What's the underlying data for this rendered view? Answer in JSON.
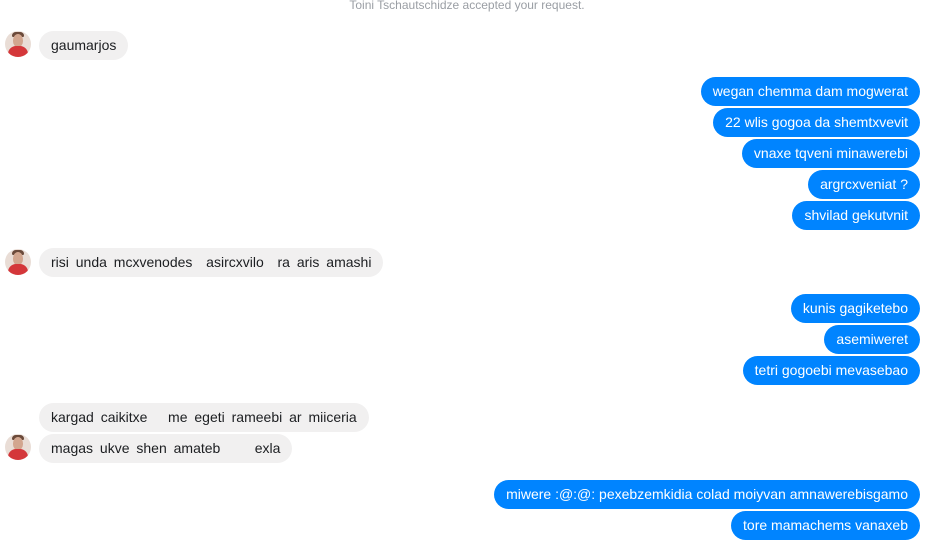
{
  "system_notice": "Toini Tschautschidze accepted your request.",
  "avatar_icon": "user-avatar-icon",
  "colors": {
    "outgoing_bubble": "#0084ff",
    "incoming_bubble": "#f1f0f0",
    "outgoing_text": "#ffffff",
    "incoming_text": "#1c1e21"
  },
  "messages": [
    {
      "direction": "incoming",
      "text": "gaumarjos"
    },
    {
      "direction": "outgoing",
      "text": "wegan chemma dam mogwerat"
    },
    {
      "direction": "outgoing",
      "text": "22 wlis gogoa da shemtxvevit"
    },
    {
      "direction": "outgoing",
      "text": "vnaxe tqveni minawerebi"
    },
    {
      "direction": "outgoing",
      "text": "argrcxveniat ?"
    },
    {
      "direction": "outgoing",
      "text": "shvilad gekutvnit"
    },
    {
      "direction": "incoming",
      "text": "risi unda mcxvenodes  asircxvilo  ra aris amashi"
    },
    {
      "direction": "outgoing",
      "text": "kunis gagiketebo"
    },
    {
      "direction": "outgoing",
      "text": "asemiweret"
    },
    {
      "direction": "outgoing",
      "text": "tetri gogoebi mevasebao"
    },
    {
      "direction": "incoming",
      "text": "kargad caikitxe   me egeti rameebi ar miiceria"
    },
    {
      "direction": "incoming",
      "text": "magas ukve shen amateb     exla"
    },
    {
      "direction": "outgoing",
      "text": "miwere :@:@: pexebzemkidia colad moiyvan amnawerebisgamo"
    },
    {
      "direction": "outgoing",
      "text": "tore mamachems vanaxeb"
    }
  ]
}
